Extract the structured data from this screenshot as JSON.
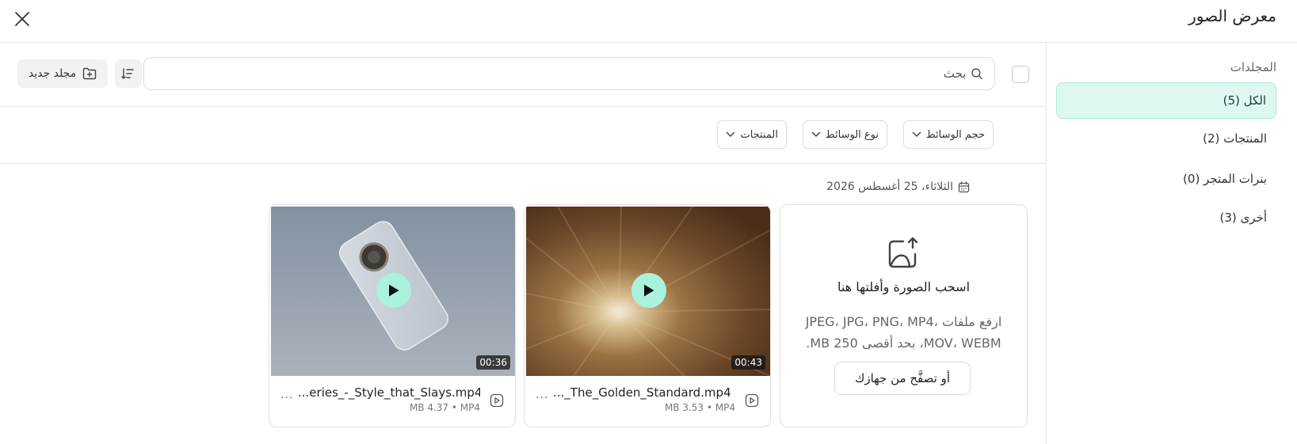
{
  "header": {
    "title": "معرض الصور"
  },
  "sidebar": {
    "label": "المجلدات",
    "items": [
      {
        "label": "الكل (5)",
        "active": true
      },
      {
        "label": "المنتجات (2)",
        "active": false
      },
      {
        "label": "بنرات المتجر (0)",
        "active": false
      },
      {
        "label": "أخرى (3)",
        "active": false
      }
    ]
  },
  "toolbar": {
    "search_placeholder": "بحث",
    "new_folder_label": "مجلد جديد"
  },
  "filters": [
    {
      "label": "حجم الوسائط"
    },
    {
      "label": "نوع الوسائط"
    },
    {
      "label": "المنتجات"
    }
  ],
  "date_label": "الثلاثاء، 25 أغسطس 2026",
  "upload": {
    "title": "اسحب الصورة وأفلتها هنا",
    "description": "ارفع ملفات JPEG، JPG، PNG، MP4، MOV، WEBM، بحد أقصى 250 MB.",
    "browse_label": "أو تصفَّح من جهازك"
  },
  "videos": [
    {
      "name": "..._The_Golden_Standard.mp4",
      "info": "MB 3.53 • MP4",
      "duration": "00:43"
    },
    {
      "name": "...eries_-_Style_that_Slays.mp4",
      "info": "MB 4.37 • MP4",
      "duration": "00:36"
    }
  ],
  "colors": {
    "accent": "#aaf2de",
    "active_bg": "#ddf8f1",
    "active_border": "#a6ecd9"
  }
}
